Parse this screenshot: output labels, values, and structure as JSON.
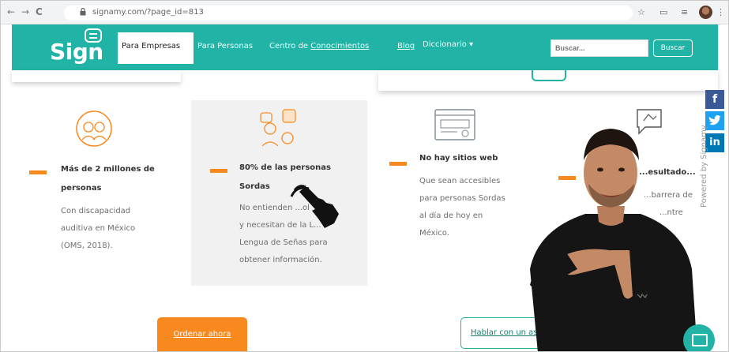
{
  "browser": {
    "back": "←",
    "forward": "→",
    "reload": "C",
    "url": "signamy.com/?page_id=813",
    "icons": [
      "star-icon",
      "cast-icon",
      "media-icon",
      "profile-avatar"
    ]
  },
  "navbar": {
    "logo": "Sign",
    "items": {
      "empresas": "Para Empresas",
      "personas": "Para Personas",
      "centro_prefix": "Centro de ",
      "centro_link": "Conocimientos",
      "blog": "Blog",
      "diccionario": "Diccionario ▾"
    },
    "search": {
      "placeholder": "Buscar...",
      "button": "Buscar"
    }
  },
  "features": [
    {
      "title_line1": "Más de 2 millones de",
      "title_line2": "personas",
      "body": [
        "Con discapacidad",
        "auditiva en México",
        "(OMS, 2018)."
      ],
      "icon": "people-faces-icon"
    },
    {
      "title_line1": "80% de las personas",
      "title_line2": "Sordas",
      "body": [
        "No entienden ...ol",
        "y necesitan de la L...",
        "Lengua de Señas para",
        "obtener información."
      ],
      "icon": "conversation-faces-icon"
    },
    {
      "title_line1": "No hay sitios web",
      "title_line2": "",
      "body": [
        "Que sean accesibles",
        "para personas Sordas",
        "al día de hoy en",
        "México."
      ],
      "icon": "website-window-icon"
    },
    {
      "title_line1": "...esultado...",
      "title_line2": "",
      "body": [
        "...barrera de",
        "...ntre",
        ""
      ],
      "icon": "hand-chat-icon"
    }
  ],
  "buttons": {
    "order": "Ordenar ahora",
    "talk": "Hablar con un ase..."
  },
  "social": {
    "facebook": "f",
    "twitter": "t",
    "linkedin": "in",
    "powered": "Powered by Signamy"
  },
  "colors": {
    "teal": "#21b3a6",
    "orange": "#f7891f",
    "gray_card": "#f1f1f1"
  }
}
